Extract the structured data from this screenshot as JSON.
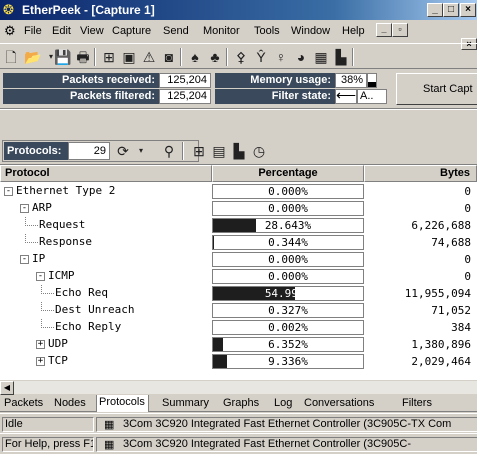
{
  "window": {
    "title": "EtherPeek - [Capture 1]"
  },
  "menu": {
    "items": [
      "File",
      "Edit",
      "View",
      "Capture",
      "Send",
      "Monitor",
      "Tools",
      "Window",
      "Help"
    ]
  },
  "stats": {
    "packets_received_label": "Packets received:",
    "packets_received_value": "125,204",
    "packets_filtered_label": "Packets filtered:",
    "packets_filtered_value": "125,204",
    "memory_usage_label": "Memory usage:",
    "memory_usage_value": "38%",
    "memory_usage_fraction": 0.38,
    "filter_state_label": "Filter state:",
    "filter_state_value": "A..",
    "start_button_label": "Start Capt"
  },
  "protocols_bar": {
    "label": "Protocols:",
    "count": "29"
  },
  "table": {
    "headers": {
      "protocol": "Protocol",
      "percentage": "Percentage",
      "bytes": "Bytes"
    },
    "rows": [
      {
        "name": "Ethernet Type 2",
        "depth": 0,
        "toggle": "−",
        "pct": "0.000%",
        "pct_value": 0.0,
        "bytes": "0"
      },
      {
        "name": "ARP",
        "depth": 1,
        "toggle": "−",
        "pct": "0.000%",
        "pct_value": 0.0,
        "bytes": "0"
      },
      {
        "name": "Request",
        "depth": 2,
        "toggle": "",
        "pct": "28.643%",
        "pct_value": 28.643,
        "bytes": "6,226,688"
      },
      {
        "name": "Response",
        "depth": 2,
        "toggle": "",
        "pct": "0.344%",
        "pct_value": 0.344,
        "bytes": "74,688"
      },
      {
        "name": "IP",
        "depth": 1,
        "toggle": "−",
        "pct": "0.000%",
        "pct_value": 0.0,
        "bytes": "0"
      },
      {
        "name": "ICMP",
        "depth": 2,
        "toggle": "−",
        "pct": "0.000%",
        "pct_value": 0.0,
        "bytes": "0"
      },
      {
        "name": "Echo Req",
        "depth": 3,
        "toggle": "",
        "pct": "54.994%",
        "pct_value": 54.994,
        "bytes": "11,955,094"
      },
      {
        "name": "Dest Unreach",
        "depth": 3,
        "toggle": "",
        "pct": "0.327%",
        "pct_value": 0.327,
        "bytes": "71,052"
      },
      {
        "name": "Echo Reply",
        "depth": 3,
        "toggle": "",
        "pct": "0.002%",
        "pct_value": 0.002,
        "bytes": "384"
      },
      {
        "name": "UDP",
        "depth": 2,
        "toggle": "+",
        "pct": "6.352%",
        "pct_value": 6.352,
        "bytes": "1,380,896"
      },
      {
        "name": "TCP",
        "depth": 2,
        "toggle": "+",
        "pct": "9.336%",
        "pct_value": 9.336,
        "bytes": "2,029,464"
      }
    ]
  },
  "tabs": [
    "Packets",
    "Nodes",
    "Protocols",
    "Summary",
    "Graphs",
    "Log",
    "Conversations",
    "Filters"
  ],
  "active_tab": "Protocols",
  "status": {
    "row1_left": "Idle",
    "row1_right": "3Com 3C920 Integrated Fast Ethernet Controller (3C905C-TX Com",
    "row2_left": "For Help, press F1",
    "row2_right": "3Com 3C920 Integrated Fast Ethernet Controller (3C905C-"
  }
}
